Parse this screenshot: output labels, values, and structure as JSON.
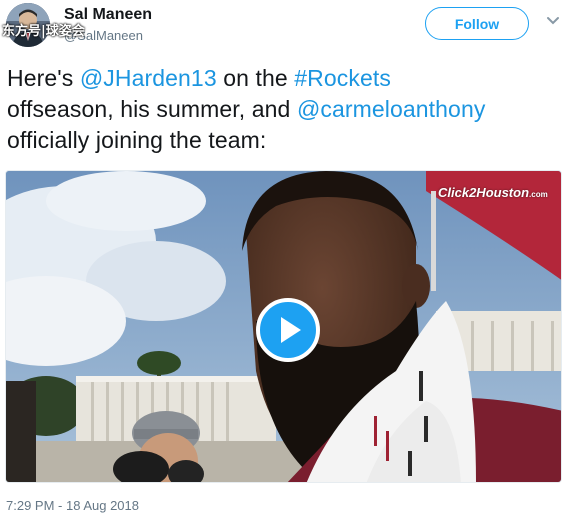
{
  "author": {
    "display_name": "Sal Maneen",
    "handle": "@SalManeen",
    "avatar_icon": "profile-avatar",
    "watermark": "东方号|球姿会"
  },
  "follow": {
    "label": "Follow"
  },
  "tweet": {
    "parts": {
      "p1": "Here's ",
      "mention1": "@JHarden13",
      "p2": " on the ",
      "hashtag": "#Rockets",
      "p3": " offseason, his summer, and ",
      "mention2": "@carmeloanthony",
      "p4": " officially joining the team:"
    }
  },
  "media": {
    "type": "video",
    "play_icon": "play-icon",
    "logo_text": "Click2Houston",
    "logo_suffix": ".com"
  },
  "timestamp": "7:29 PM - 18 Aug 2018",
  "colors": {
    "accent": "#1da1f2",
    "link": "#1b95e0",
    "text": "#14171a",
    "muted": "#657786"
  }
}
